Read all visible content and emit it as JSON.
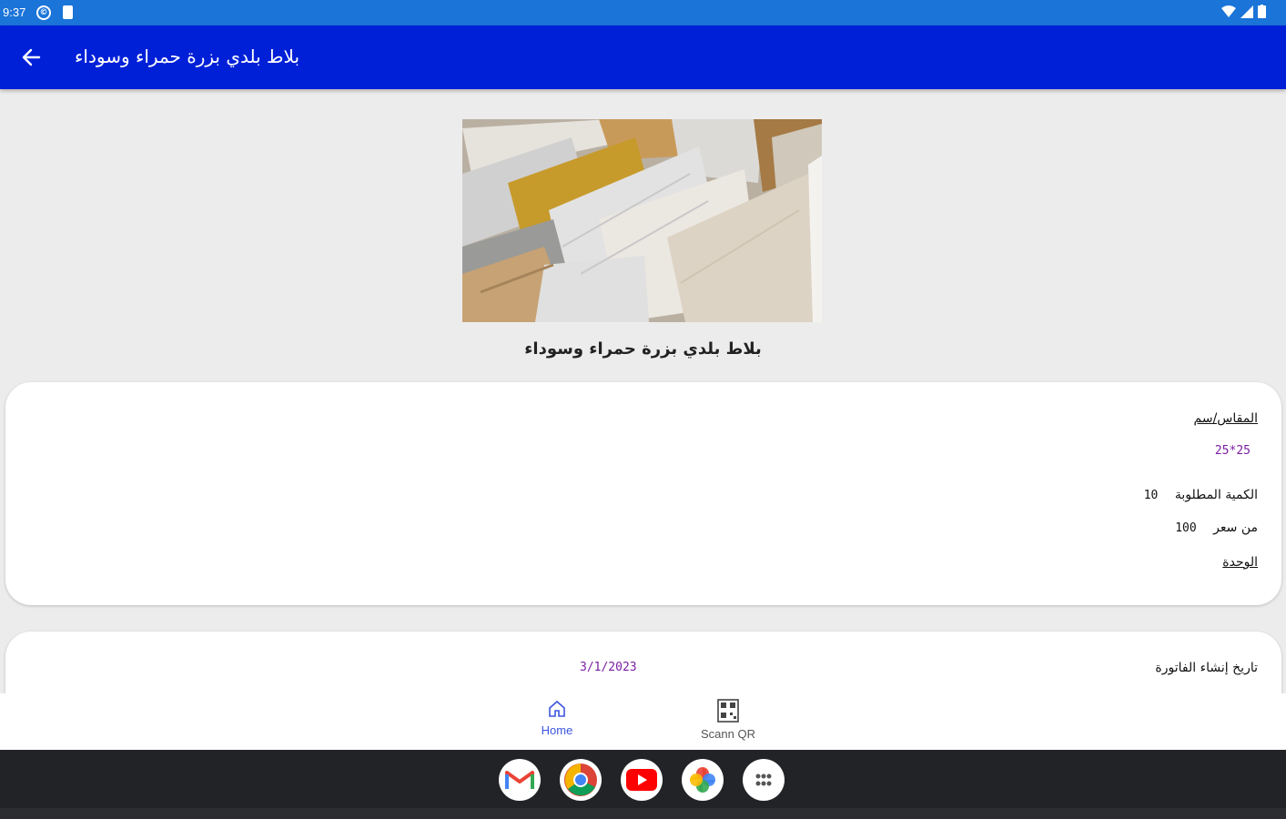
{
  "status_bar": {
    "time": "9:37"
  },
  "app_bar": {
    "title": "بلاط بلدي بزرة حمراء وسوداء",
    "back_icon": "arrow-left-icon"
  },
  "product": {
    "name": "بلاط بلدي بزرة حمراء وسوداء"
  },
  "details": {
    "size_label": "المقاس/سم",
    "size_value": "25*25",
    "quantity_label": "الكمية المطلوبة",
    "quantity_value": "10",
    "price_label": "من سعر",
    "price_value": "100",
    "unit_label": "الوحدة"
  },
  "invoice": {
    "date_label": "تاريخ إنشاء الفاتورة",
    "date_value": "3/1/2023"
  },
  "bottom_nav": {
    "items": [
      {
        "label": "Home",
        "icon": "home-icon",
        "active": true
      },
      {
        "label": "Scann QR",
        "icon": "qr-code-icon",
        "active": false
      }
    ]
  },
  "dock": {
    "apps": [
      "gmail-icon",
      "chrome-icon",
      "youtube-icon",
      "photos-icon",
      "app-launcher-icon"
    ]
  },
  "colors": {
    "status_bar": "#1b74d8",
    "app_bar": "#0020d8",
    "accent_purple": "#7b1fa2",
    "nav_active": "#3d55e0"
  }
}
